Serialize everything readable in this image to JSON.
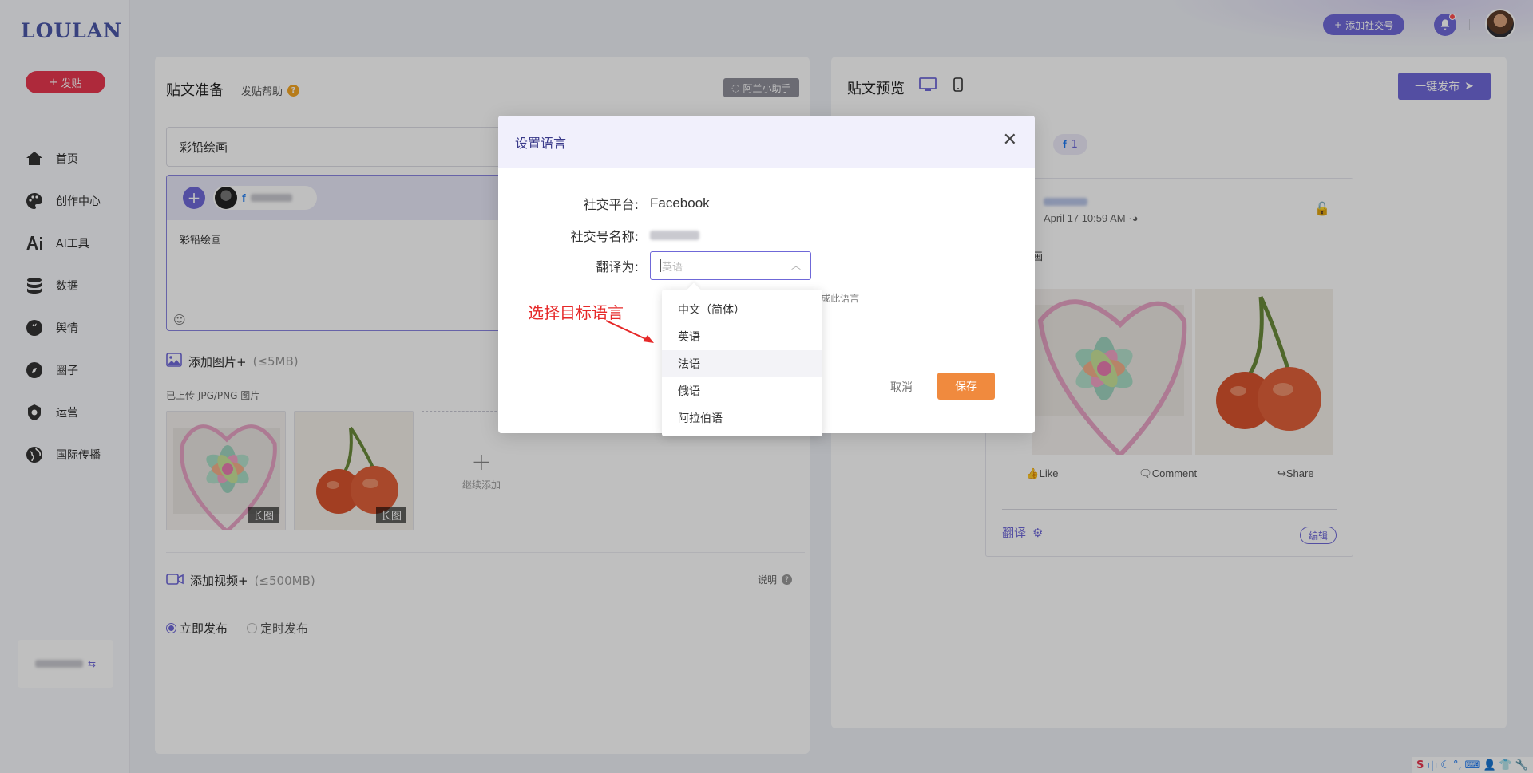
{
  "app": {
    "logo": "LOULAN"
  },
  "sidebar": {
    "post_button": "发贴",
    "items": [
      {
        "label": "首页",
        "icon": "home-icon"
      },
      {
        "label": "创作中心",
        "icon": "palette-icon"
      },
      {
        "label": "AI工具",
        "icon": "ai-icon"
      },
      {
        "label": "数据",
        "icon": "database-icon"
      },
      {
        "label": "舆情",
        "icon": "quote-icon"
      },
      {
        "label": "圈子",
        "icon": "compass-icon"
      },
      {
        "label": "运营",
        "icon": "operations-icon"
      },
      {
        "label": "国际传播",
        "icon": "globe-icon"
      }
    ]
  },
  "topbar": {
    "add_social": "添加社交号"
  },
  "left_panel": {
    "title": "贴文准备",
    "help": "发贴帮助",
    "assistant": "阿兰小助手",
    "post_title": "彩铅绘画",
    "post_body": "彩铅绘画",
    "add_image": "添加图片+",
    "image_limit": "(≤5MB)",
    "uploaded_note": "已上传 JPG/PNG 图片",
    "long_image_tag": "长图",
    "add_more": "继续添加",
    "add_video": "添加视频+",
    "video_limit": "(≤500MB)",
    "explain": "说明",
    "publish_now": "立即发布",
    "schedule": "定时发布"
  },
  "right_panel": {
    "title": "贴文预览",
    "publish_all": "一键发布",
    "fb_count": "1",
    "post_date": "April 17 10:59 AM ·",
    "post_text_fragment": "画",
    "like": "Like",
    "comment": "Comment",
    "share": "Share",
    "translate": "翻译",
    "edit": "编辑"
  },
  "modal": {
    "title": "设置语言",
    "platform_label": "社交平台:",
    "platform_value": "Facebook",
    "account_label": "社交号名称:",
    "translate_label": "翻译为:",
    "select_placeholder": "英语",
    "hint_fragment": "成此语言",
    "cancel": "取消",
    "save": "保存",
    "options": [
      "中文（简体）",
      "英语",
      "法语",
      "俄语",
      "阿拉伯语"
    ],
    "hovered_option": "法语"
  },
  "annotation": {
    "text": "选择目标语言",
    "color": "#e62929"
  },
  "colors": {
    "accent": "#6f68d8",
    "post_button": "#e8374f",
    "save": "#f08a3e"
  },
  "tray": {
    "ime": "中"
  }
}
